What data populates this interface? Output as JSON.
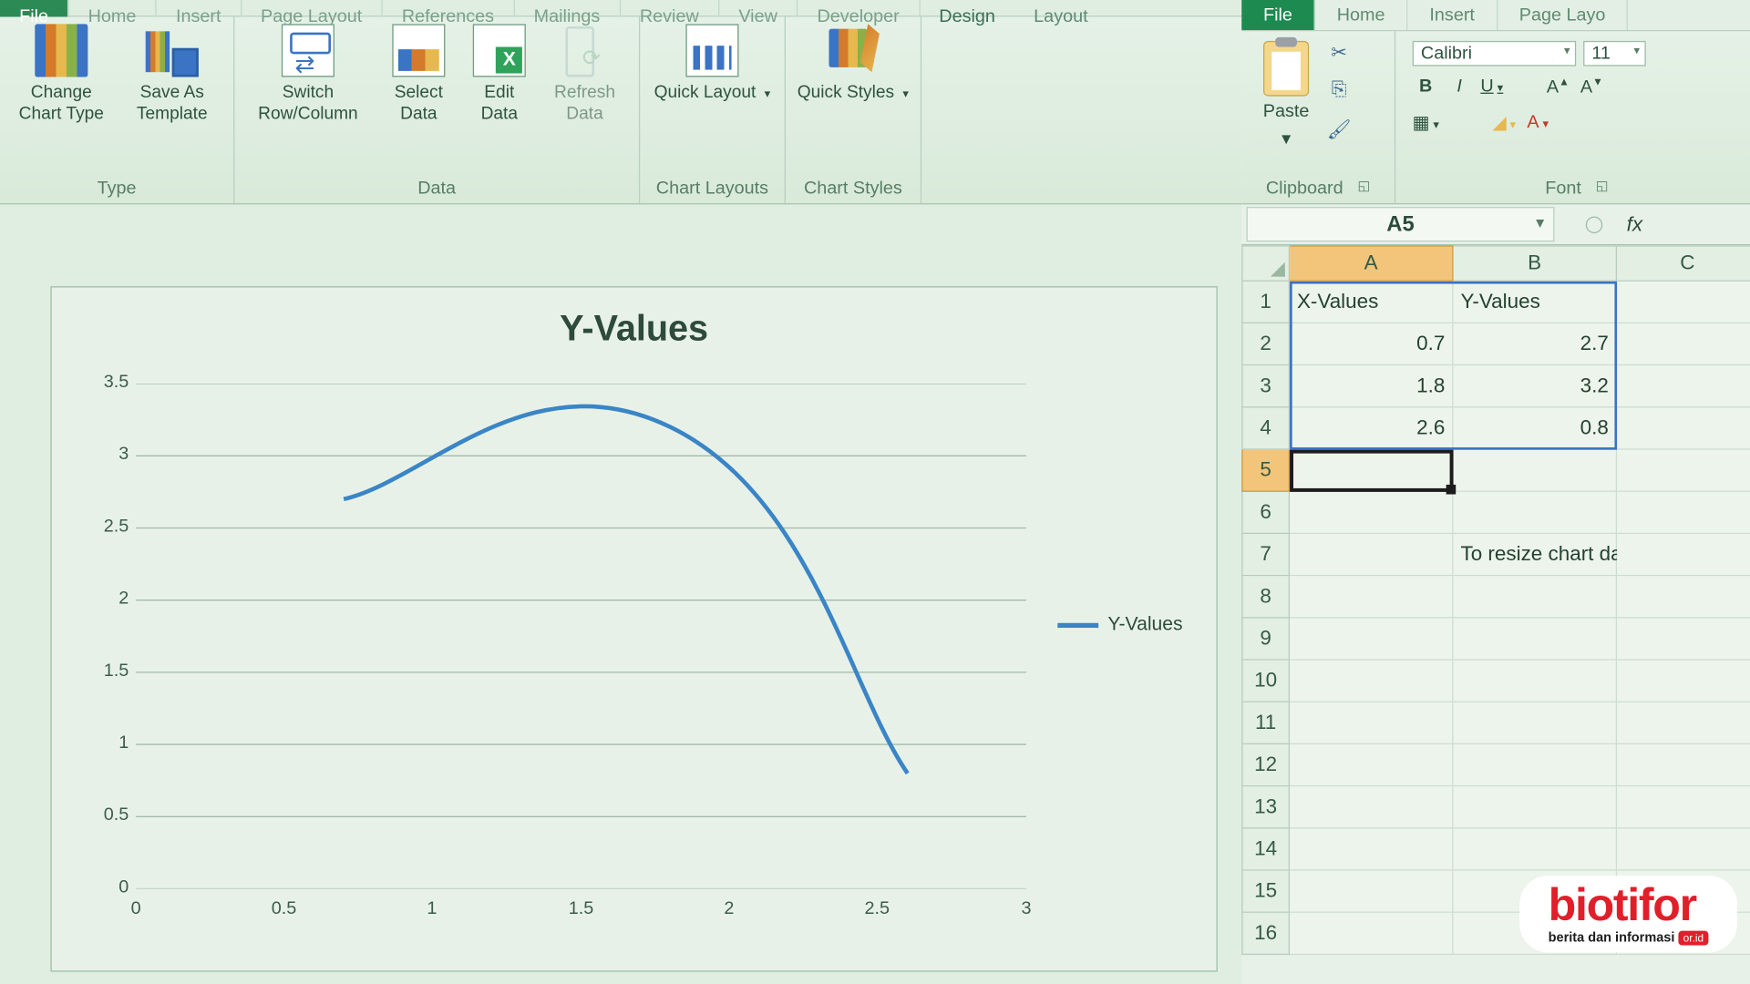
{
  "left": {
    "tabs": [
      "File",
      "Home",
      "Insert",
      "Page Layout",
      "References",
      "Mailings",
      "Review",
      "View",
      "Developer",
      "Design",
      "Layout"
    ],
    "ribbon": {
      "type_group": {
        "label": "Type",
        "change": "Change\nChart Type",
        "save": "Save As\nTemplate"
      },
      "data_group": {
        "label": "Data",
        "switch": "Switch\nRow/Column",
        "select": "Select\nData",
        "edit": "Edit\nData",
        "refresh": "Refresh\nData"
      },
      "layouts_group": {
        "label": "Chart Layouts",
        "quick": "Quick\nLayout"
      },
      "styles_group": {
        "label": "Chart Styles",
        "quick": "Quick\nStyles"
      }
    }
  },
  "right": {
    "tabs": [
      "File",
      "Home",
      "Insert",
      "Page Layo"
    ],
    "clipboard": {
      "label": "Clipboard",
      "paste": "Paste"
    },
    "font": {
      "label": "Font",
      "name": "Calibri",
      "size": "11"
    },
    "namebox": "A5",
    "fx": "fx",
    "cols": [
      "A",
      "B",
      "C"
    ],
    "rows": [
      "1",
      "2",
      "3",
      "4",
      "5",
      "6",
      "7",
      "8",
      "9",
      "10",
      "11",
      "12",
      "13",
      "14",
      "15",
      "16"
    ],
    "cells": {
      "A1": "X-Values",
      "B1": "Y-Values",
      "A2": "0.7",
      "B2": "2.7",
      "A3": "1.8",
      "B3": "3.2",
      "A4": "2.6",
      "B4": "0.8",
      "B7": "To resize chart data ra"
    }
  },
  "watermark": {
    "brand": "biotifor",
    "tagline": "berita dan informasi",
    "badge": "or.id"
  },
  "chart_data": {
    "type": "line",
    "title": "Y-Values",
    "series": [
      {
        "name": "Y-Values",
        "x": [
          0.7,
          1.8,
          2.6
        ],
        "y": [
          2.7,
          3.2,
          0.8
        ]
      }
    ],
    "xlabel": "",
    "ylabel": "",
    "xlim": [
      0,
      3
    ],
    "ylim": [
      0,
      3.5
    ],
    "xticks": [
      0,
      0.5,
      1,
      1.5,
      2,
      2.5,
      3
    ],
    "yticks": [
      0,
      0.5,
      1,
      1.5,
      2,
      2.5,
      3,
      3.5
    ],
    "legend": "Y-Values"
  }
}
